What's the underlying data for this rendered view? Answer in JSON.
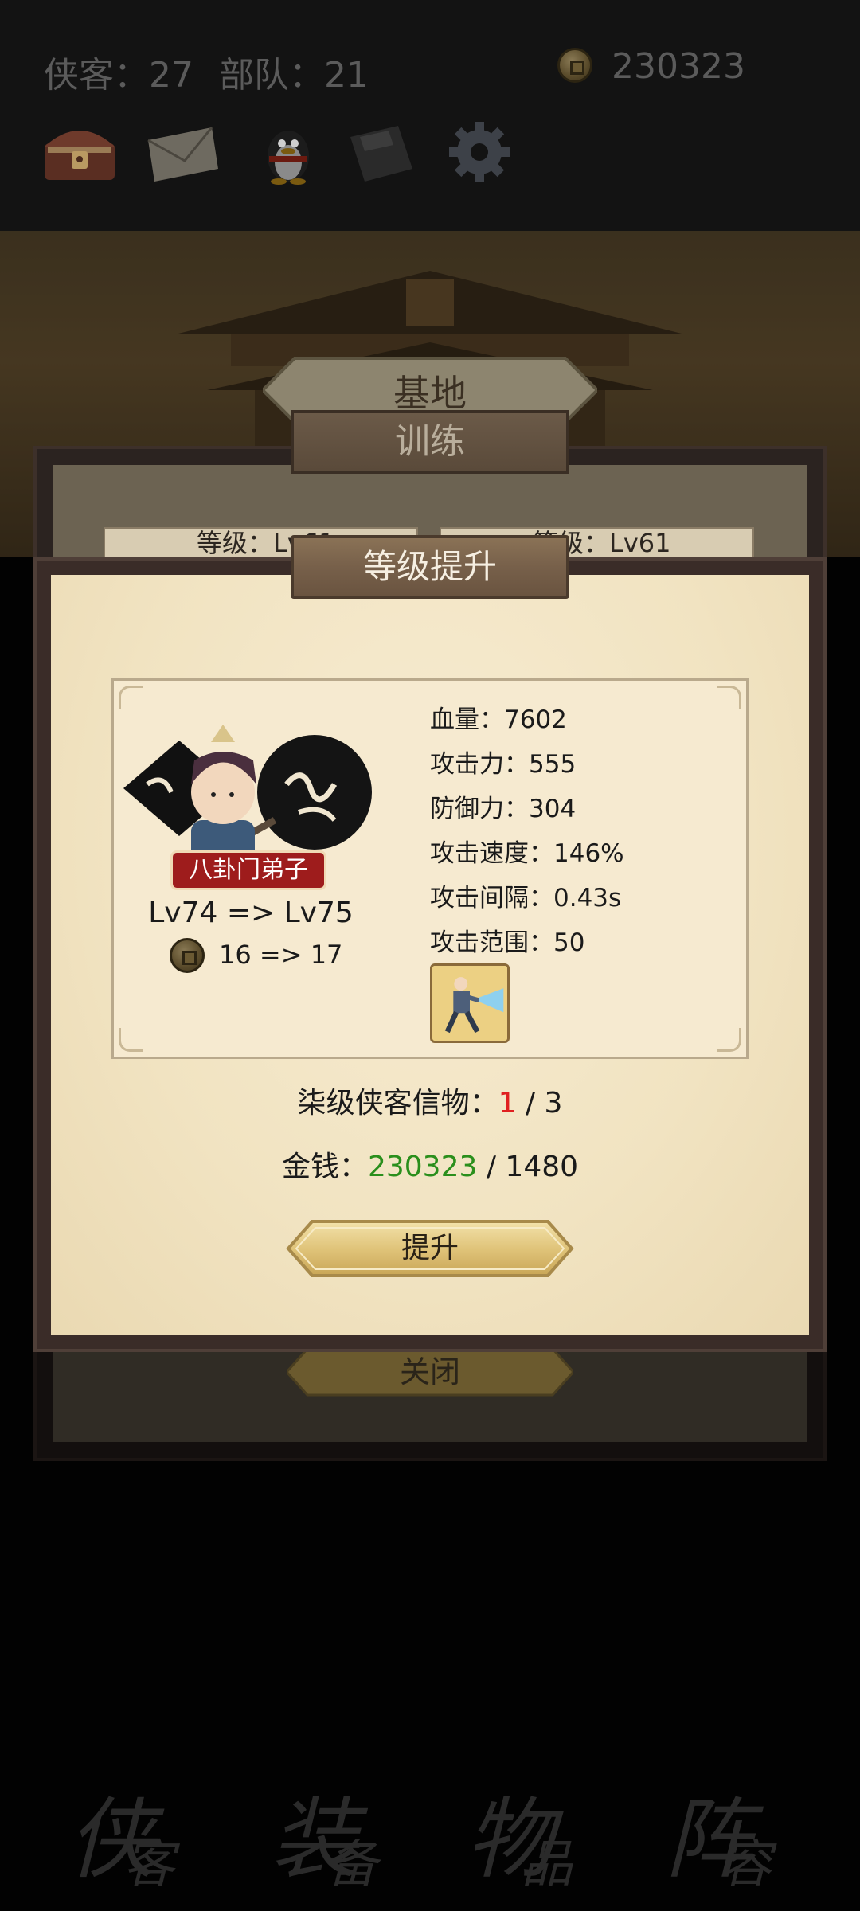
{
  "header": {
    "heroes_text": "侠客：27",
    "troops_text": "部队：21",
    "gold": "230323",
    "icons": [
      "chest-icon",
      "mail-icon",
      "qq-penguin-icon",
      "save-disk-icon",
      "gear-icon"
    ]
  },
  "base_screen": {
    "title": "基地",
    "tab": "训练",
    "level_left": "等级：Lv61",
    "level_right": "等级：Lv61",
    "close_label": "关闭"
  },
  "levelup": {
    "title": "等级提升",
    "hero_name": "八卦门弟子",
    "level_change": "Lv74 => Lv75",
    "cost_change": "16 => 17",
    "stats": [
      {
        "label": "血量：7602"
      },
      {
        "label": "攻击力：555"
      },
      {
        "label": "防御力：304"
      },
      {
        "label": "攻击速度：146%"
      },
      {
        "label": "攻击间隔：0.43s"
      },
      {
        "label": "攻击范围：50"
      }
    ],
    "token": {
      "prefix": "柒级侠客信物：",
      "have": "1",
      "need": " / 3"
    },
    "money": {
      "prefix": "金钱：",
      "have": "230323",
      "need": " / 1480"
    },
    "upgrade_label": "提升"
  },
  "bottom_nav": [
    {
      "big": "侠",
      "small": "客"
    },
    {
      "big": "装",
      "small": "备"
    },
    {
      "big": "物",
      "small": "品"
    },
    {
      "big": "阵",
      "small": "容"
    }
  ],
  "colors": {
    "highlight_red": "#e02020",
    "highlight_green": "#2a8f1c",
    "tag_red": "#9e1c1c"
  }
}
